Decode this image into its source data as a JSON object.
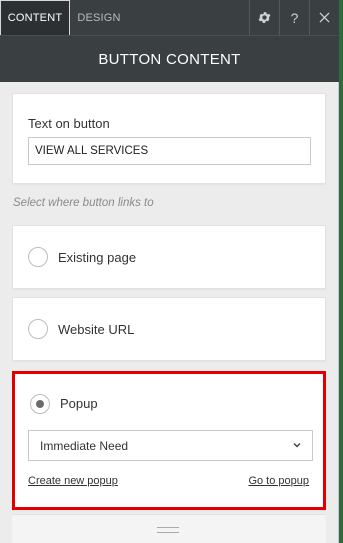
{
  "tabs": [
    {
      "label": "CONTENT",
      "active": true
    },
    {
      "label": "DESIGN",
      "active": false
    }
  ],
  "toolbar": {
    "settings_icon": "gear-icon",
    "help_label": "?",
    "close_icon": "close-icon"
  },
  "header": {
    "title": "BUTTON CONTENT"
  },
  "button_text": {
    "label": "Text on button",
    "value": "VIEW ALL SERVICES"
  },
  "link_hint": "Select where button links to",
  "options": [
    {
      "label": "Existing page",
      "selected": false
    },
    {
      "label": "Website URL",
      "selected": false
    },
    {
      "label": "Popup",
      "selected": true
    }
  ],
  "popup": {
    "selected": "Immediate Need",
    "create_link": "Create new popup",
    "go_link": "Go to popup"
  },
  "colors": {
    "highlight_border": "#e00000",
    "topbar_bg": "#3a3f41"
  }
}
